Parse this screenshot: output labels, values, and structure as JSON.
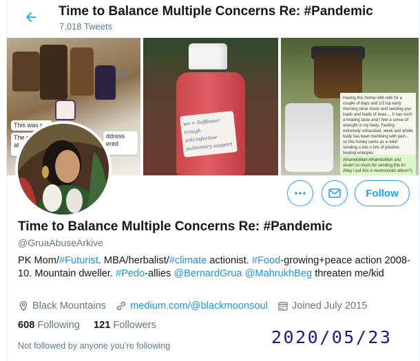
{
  "header": {
    "title": "Time to Balance Multiple Concerns Re: #Pandemic",
    "tweet_count": "7,018 Tweets",
    "back_icon": "arrow-left-icon"
  },
  "banner": {
    "panel1_text_lines": [
      "This was r",
      "The c",
      "at"
    ],
    "panel1_right_lines": [
      "ddress",
      "ered"
    ],
    "panel2_label_lines": [
      "ws + Safflower (cough",
      "anti-infective",
      "pulmonary support"
    ],
    "panel3_chat": "Having this honey with milk for a couple of days and 1/2 tsp early morning ninar moon and sending you loads and loads of duas.... It has such a heating taste and I feel a sense of strength in my body. Feeling extremely exhausted, week and whole body has been trembling with pain... so this honey came as a relief sending u lots n lots of positive healing energies",
    "panel3_green_chat": "Alhamdolillah Alhamdolillah and shukr! so much for sending this in! (May I put this in testimonials album?)"
  },
  "actions": {
    "more_icon": "more-dots-icon",
    "message_icon": "envelope-icon",
    "follow_label": "Follow"
  },
  "profile": {
    "name": "Time to Balance Multiple Concerns Re: #Pandemic",
    "handle": "@GruaAbuseArkive",
    "bio": {
      "t1": "PK Mom/",
      "h1": "#Futurist",
      "t2": ". MBA/herbalist/",
      "h2": "#climate",
      "t3": " actionist. ",
      "h3": "#Food",
      "t4": "-growing+peace action 2008-10. Mountain dweller. ",
      "h4": "#Pedo",
      "t5": "-allies ",
      "m1": "@BernardGrua",
      "t6": " ",
      "m2": "@MahrukhBeg",
      "t7": " threaten me/kid"
    },
    "location": "Black Mountains",
    "website": "medium.com/@blackmoonsoul",
    "joined": "Joined July 2015",
    "following_count": "608",
    "following_label": "Following",
    "followers_count": "121",
    "followers_label": "Followers",
    "not_followed": "Not followed by anyone you’re following"
  },
  "overlay": {
    "date_stamp": "2020/05/23"
  },
  "colors": {
    "accent": "#1da1f2",
    "link": "#1b95e0",
    "muted": "#657786",
    "stamp": "#1a1a8a"
  }
}
